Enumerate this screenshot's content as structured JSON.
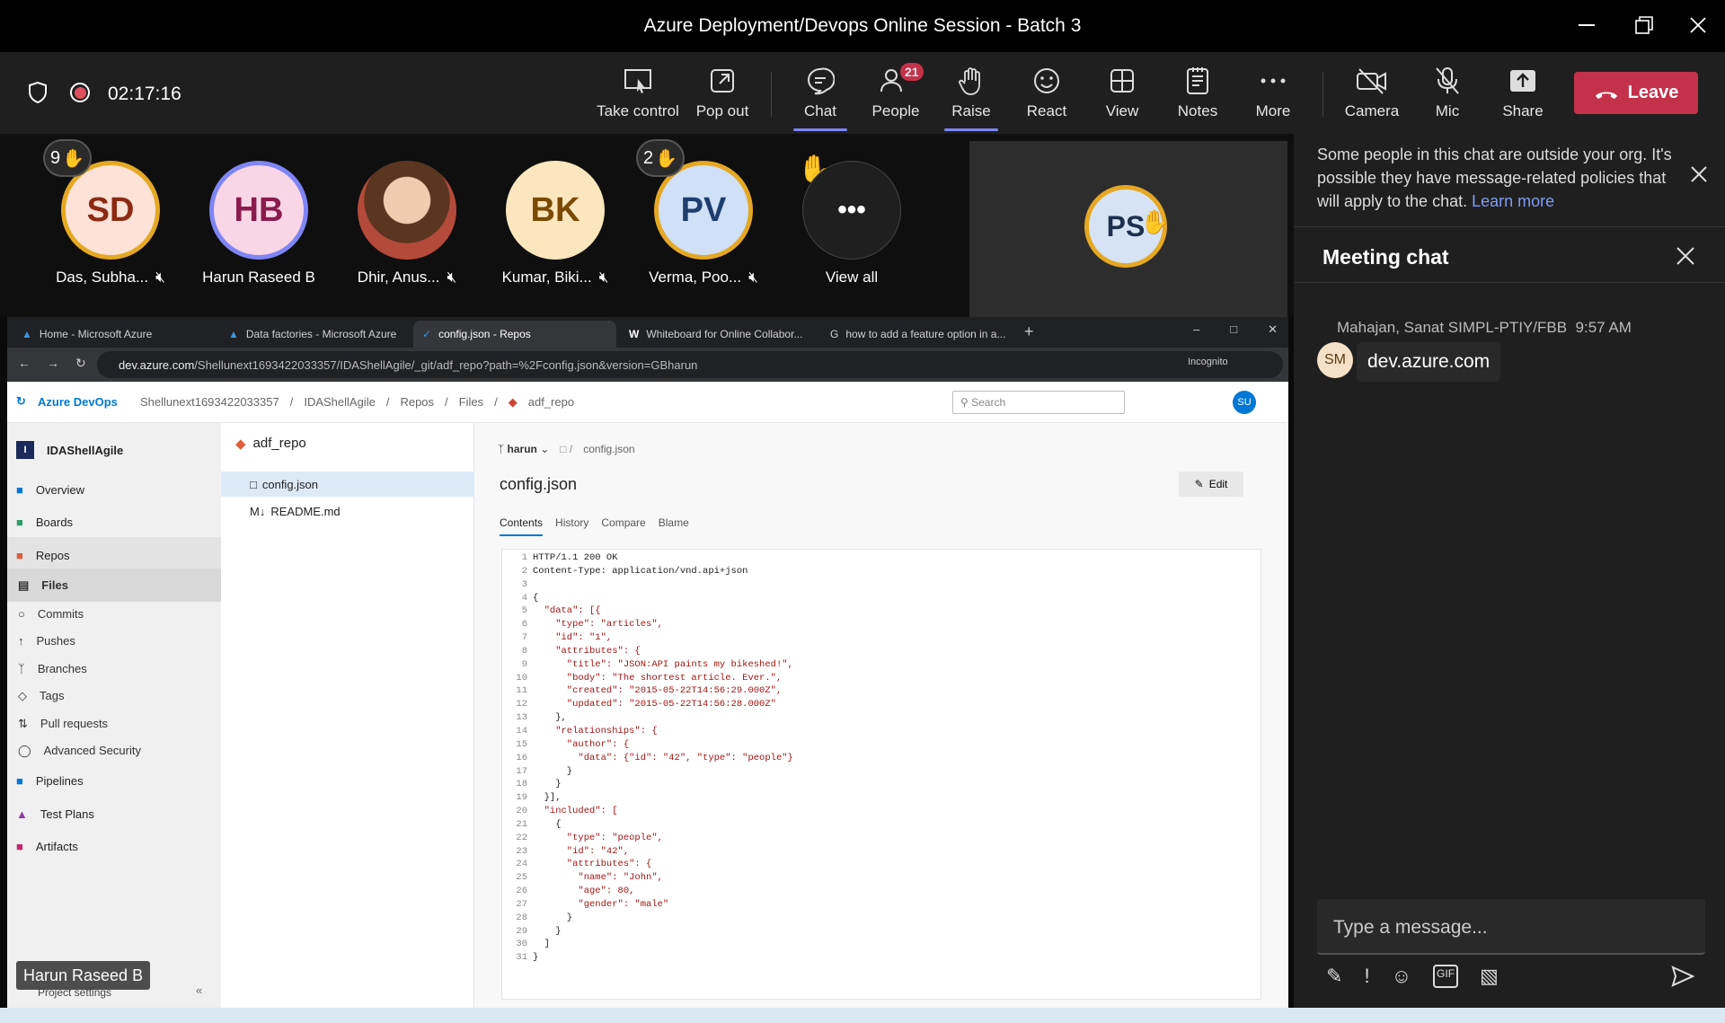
{
  "window": {
    "title": "Azure Deployment/Devops Online Session - Batch 3"
  },
  "toolbar": {
    "timer": "02:17:16",
    "items": [
      {
        "label": "Take control"
      },
      {
        "label": "Pop out"
      },
      {
        "label": "Chat"
      },
      {
        "label": "People",
        "badge": "21"
      },
      {
        "label": "Raise"
      },
      {
        "label": "React"
      },
      {
        "label": "View"
      },
      {
        "label": "Notes"
      },
      {
        "label": "More"
      },
      {
        "label": "Camera"
      },
      {
        "label": "Mic"
      },
      {
        "label": "Share"
      }
    ],
    "leave": "Leave"
  },
  "participants": [
    {
      "initials": "SD",
      "name": "Das, Subha...",
      "hand_count": "9"
    },
    {
      "initials": "HB",
      "name": "Harun Raseed B"
    },
    {
      "initials": "",
      "name": "Dhir, Anus..."
    },
    {
      "initials": "BK",
      "name": "Kumar, Biki..."
    },
    {
      "initials": "PV",
      "name": "Verma, Poo...",
      "hand_count": "2"
    },
    {
      "initials": "",
      "name": "View all"
    }
  ],
  "presenter": {
    "initials": "PS"
  },
  "chat": {
    "notice": "Some people in this chat are outside your org. It's possible they have message-related policies that will apply to the chat.",
    "learn_more": "Learn more",
    "title": "Meeting chat",
    "message": {
      "sender": "Mahajan, Sanat SIMPL-PTIY/FBB",
      "time": "9:57 AM",
      "avatar": "SM",
      "text": "dev.azure.com"
    },
    "input_placeholder": "Type a message..."
  },
  "browser": {
    "tabs": [
      "Home - Microsoft Azure",
      "Data factories - Microsoft Azure",
      "config.json - Repos",
      "Whiteboard for Online Collabor...",
      "how to add a feature option in a..."
    ],
    "url_host": "dev.azure.com",
    "url_path": "/Shellunext1693422033357/IDAShellAgile/_git/adf_repo?path=%2Fconfig.json&version=GBharun",
    "incognito": "Incognito"
  },
  "ado": {
    "brand": "Azure DevOps",
    "crumbs": [
      "Shellunext1693422033357",
      "IDAShellAgile",
      "Repos",
      "Files",
      "adf_repo"
    ],
    "search": "Search",
    "user": "SU",
    "project": "IDAShellAgile",
    "nav": [
      "Overview",
      "Boards",
      "Repos",
      "Files",
      "Commits",
      "Pushes",
      "Branches",
      "Tags",
      "Pull requests",
      "Advanced Security",
      "Pipelines",
      "Test Plans",
      "Artifacts"
    ],
    "project_settings": "Project settings",
    "repo": "adf_repo",
    "files": [
      "config.json",
      "README.md"
    ],
    "branch": "harun",
    "path": "config.json",
    "file_title": "config.json",
    "edit": "Edit",
    "file_tabs": [
      "Contents",
      "History",
      "Compare",
      "Blame"
    ]
  },
  "code_lines": [
    "HTTP/1.1 200 OK",
    "Content-Type: application/vnd.api+json",
    "",
    "{",
    "  \"data\": [{",
    "    \"type\": \"articles\",",
    "    \"id\": \"1\",",
    "    \"attributes\": {",
    "      \"title\": \"JSON:API paints my bikeshed!\",",
    "      \"body\": \"The shortest article. Ever.\",",
    "      \"created\": \"2015-05-22T14:56:29.000Z\",",
    "      \"updated\": \"2015-05-22T14:56:28.000Z\"",
    "    },",
    "    \"relationships\": {",
    "      \"author\": {",
    "        \"data\": {\"id\": \"42\", \"type\": \"people\"}",
    "      }",
    "    }",
    "  }],",
    "  \"included\": [",
    "    {",
    "      \"type\": \"people\",",
    "      \"id\": \"42\",",
    "      \"attributes\": {",
    "        \"name\": \"John\",",
    "        \"age\": 80,",
    "        \"gender\": \"male\"",
    "      }",
    "    }",
    "  ]",
    "}"
  ],
  "tooltip": "Harun Raseed B"
}
